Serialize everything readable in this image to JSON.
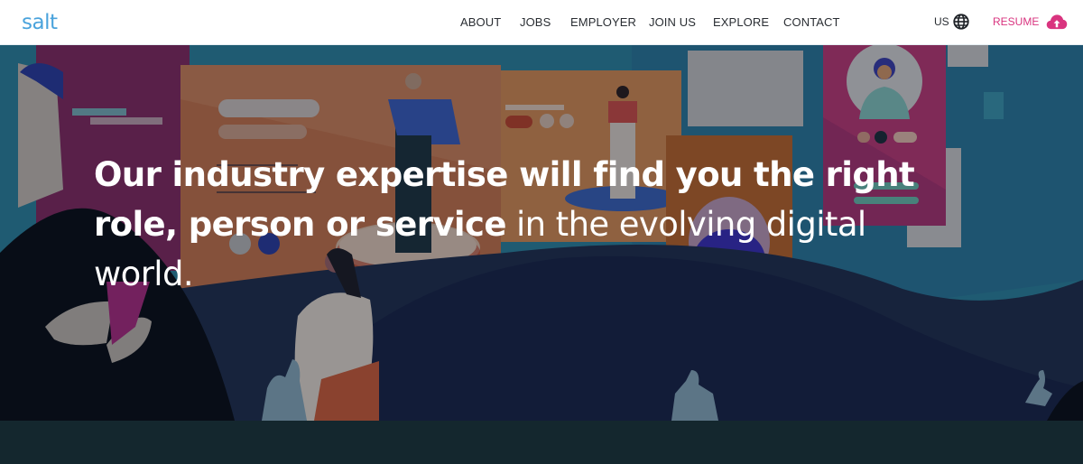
{
  "header": {
    "logo_text": "salt",
    "nav": [
      {
        "label": "ABOUT"
      },
      {
        "label": "JOBS"
      },
      {
        "label": "EMPLOYER"
      },
      {
        "label": "JOIN US"
      },
      {
        "label": "EXPLORE"
      },
      {
        "label": "CONTACT"
      }
    ],
    "region": {
      "label": "US",
      "icon": "globe-icon"
    },
    "resume": {
      "label": "RESUME",
      "icon": "cloud-upload-icon"
    }
  },
  "colors": {
    "brand_blue": "#4aa3dc",
    "resume_pink": "#d9347f",
    "nav_text": "#2a2e33",
    "headline_text": "#ffffff",
    "bottom_band": "#14272e"
  },
  "hero": {
    "headline_bold": "Our industry expertise will find you the right role, person or service",
    "headline_light": " in the evolving digital world."
  }
}
